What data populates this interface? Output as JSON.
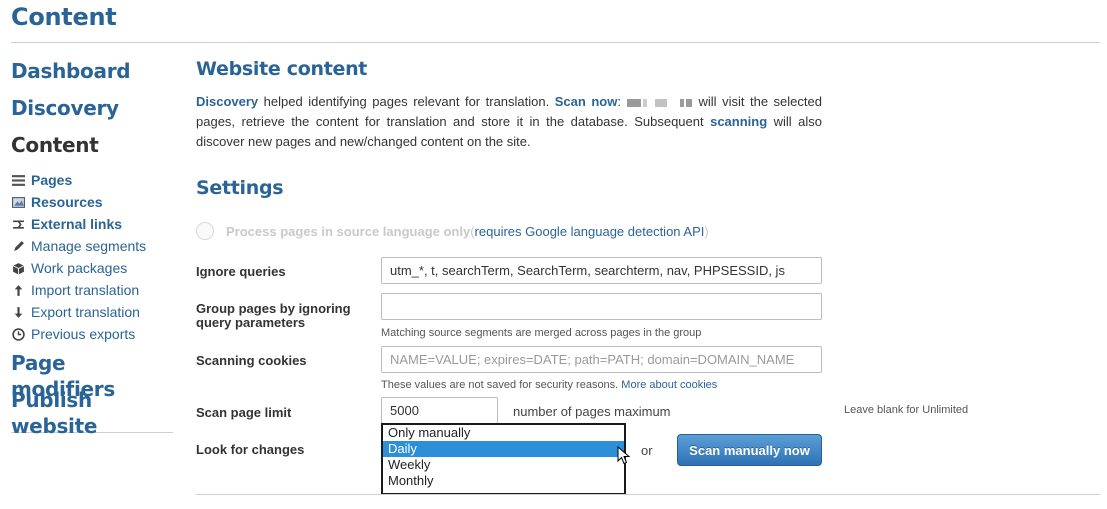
{
  "page_title": "Content",
  "sidebar": {
    "dashboard": "Dashboard",
    "discovery": "Discovery",
    "content": "Content",
    "items": [
      {
        "label": "Pages",
        "icon": "list-icon"
      },
      {
        "label": "Resources",
        "icon": "image-icon"
      },
      {
        "label": "External links",
        "icon": "link-icon"
      },
      {
        "label": "Manage segments",
        "icon": "pencil-icon"
      },
      {
        "label": "Work packages",
        "icon": "package-icon"
      },
      {
        "label": "Import translation",
        "icon": "arrow-up-icon"
      },
      {
        "label": "Export translation",
        "icon": "arrow-down-icon"
      },
      {
        "label": "Previous exports",
        "icon": "clock-icon"
      }
    ],
    "page_modifiers": "Page modifiers",
    "publish_website": "Publish website"
  },
  "main": {
    "heading": "Website content",
    "intro": {
      "discovery_link": "Discovery",
      "text1": " helped identifying pages relevant for translation. ",
      "scan_now": "Scan now",
      "text2": ": ",
      "text3": " will visit the selected pages, retrieve the content for translation and store it in the database. Subsequent ",
      "scanning_link": "scanning",
      "text4": " will also discover new pages and new/changed content on the site."
    },
    "settings_heading": "Settings",
    "process_source_only": {
      "label": "Process pages in source language only",
      "paren_open": " (",
      "link": "requires Google language detection API",
      "paren_close": ")"
    },
    "ignore_queries": {
      "label": "Ignore queries",
      "value": "utm_*, t, searchTerm, SearchTerm, searchterm, nav, PHPSESSID, js"
    },
    "group_pages": {
      "label_line1": "Group pages by ignoring",
      "label_line2": "query parameters",
      "value": "",
      "hint": "Matching source segments are merged across pages in the group"
    },
    "scanning_cookies": {
      "label": "Scanning cookies",
      "placeholder": "NAME=VALUE; expires=DATE; path=PATH; domain=DOMAIN_NAME",
      "hint": "These values are not saved for security reasons. ",
      "hint_link": "More about cookies"
    },
    "scan_page_limit": {
      "label": "Scan page limit",
      "value": "5000",
      "units": "number of pages maximum",
      "note": "Leave blank for Unlimited"
    },
    "look_for_changes": {
      "label": "Look for changes",
      "options": [
        "Only manually",
        "Daily",
        "Weekly",
        "Monthly"
      ],
      "selected": "Daily",
      "or": "or",
      "scan_button": "Scan manually now"
    }
  },
  "colors": {
    "accent": "#2a6496",
    "selected_option": "#2e8fd9",
    "button": "#2f72b5"
  }
}
